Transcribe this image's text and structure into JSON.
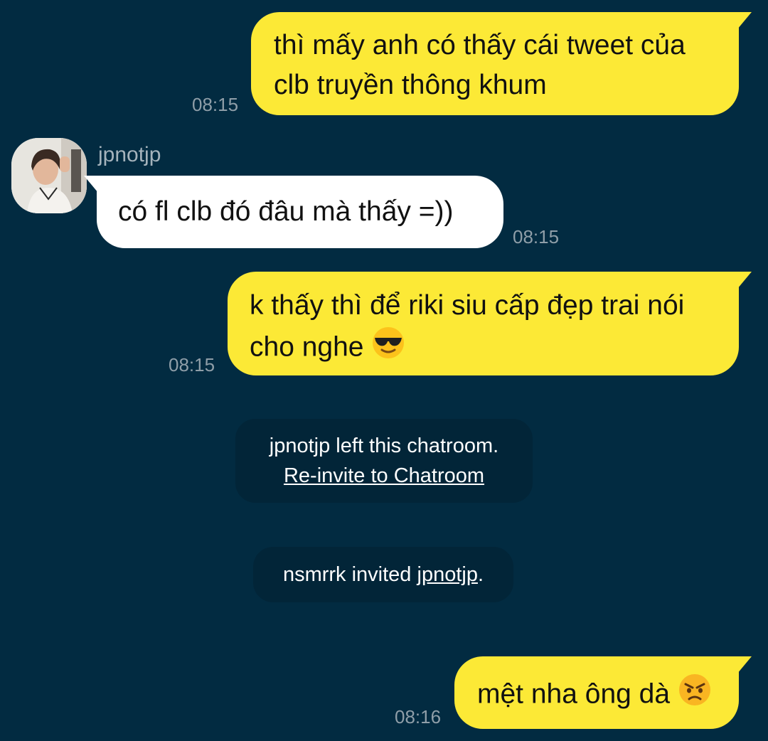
{
  "messages": [
    {
      "sender": "me",
      "lines": [
        "thì mấy anh có thấy cái tweet của",
        "clb truyền thông khum"
      ],
      "time": "08:15"
    },
    {
      "sender": "them",
      "name": "jpnotjp",
      "text": "có fl clb đó đâu mà thấy =))",
      "time": "08:15"
    },
    {
      "sender": "me",
      "lines": [
        "k thấy thì để riki siu cấp đẹp trai nói",
        "cho nghe"
      ],
      "emoji": "smiling-face-with-sunglasses-emoji",
      "time": "08:15"
    },
    {
      "sender": "me",
      "text": "mệt nha ông dà",
      "emoji": "angry-face-emoji",
      "time": "08:16"
    }
  ],
  "system": {
    "left": {
      "text": "jpnotjp left this chatroom.",
      "link": "Re-invite to Chatroom"
    },
    "invited": {
      "actor": "nsmrrk invited ",
      "target": "jpnotjp",
      "suffix": "."
    }
  },
  "colors": {
    "background": "#022b41",
    "my_bubble": "#fce936",
    "their_bubble": "#ffffff",
    "system_bubble": "#022538",
    "timestamp": "#8f9ea8"
  }
}
